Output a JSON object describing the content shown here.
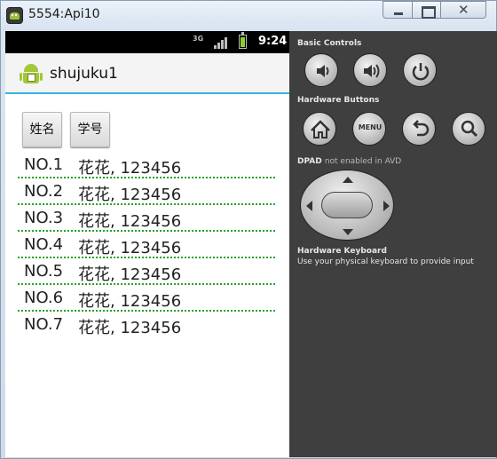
{
  "window": {
    "title": "5554:Api10"
  },
  "status_bar": {
    "network": "3G",
    "time": "9:24"
  },
  "action_bar": {
    "app_title": "shujuku1"
  },
  "buttons": {
    "name_label": "姓名",
    "id_label": "学号"
  },
  "list": {
    "rows": [
      {
        "num": "NO.1",
        "value": "花花, 123456"
      },
      {
        "num": "NO.2",
        "value": "花花, 123456"
      },
      {
        "num": "NO.3",
        "value": "花花, 123456"
      },
      {
        "num": "NO.4",
        "value": "花花, 123456"
      },
      {
        "num": "NO.5",
        "value": "花花, 123456"
      },
      {
        "num": "NO.6",
        "value": "花花, 123456"
      },
      {
        "num": "NO.7",
        "value": "花花, 123456"
      }
    ]
  },
  "controls": {
    "basic_controls_label": "Basic Controls",
    "hardware_buttons_label": "Hardware Buttons",
    "menu_label": "MENU",
    "dpad_label": "DPAD",
    "dpad_note": "not enabled in AVD",
    "keyboard_label": "Hardware Keyboard",
    "keyboard_note": "Use your physical keyboard to provide input"
  },
  "icons": {
    "basic": [
      "volume-down-icon",
      "volume-up-icon",
      "power-icon"
    ],
    "hardware": [
      "home-icon",
      "menu-icon",
      "back-icon",
      "search-icon"
    ]
  },
  "colors": {
    "action_bar_accent": "#33b5e5",
    "separator": "#28a028",
    "panel_bg": "#3f3f3f",
    "battery": "#8ccf2a"
  }
}
